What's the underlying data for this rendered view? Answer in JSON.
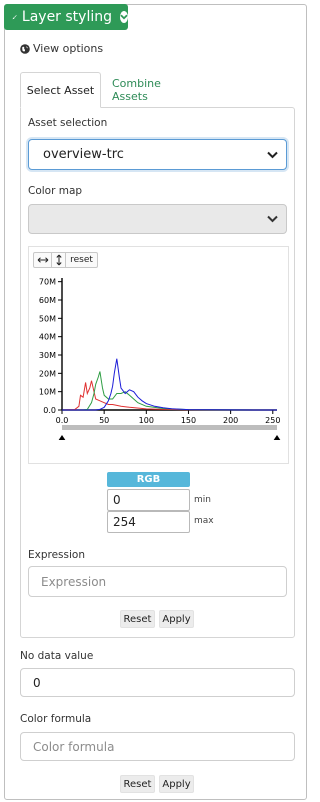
{
  "header": {
    "title": "Layer styling"
  },
  "view_options": {
    "label": "View options"
  },
  "tabs": [
    {
      "label": "Select Asset",
      "active": true
    },
    {
      "label": "Combine Assets",
      "active": false
    }
  ],
  "asset_selection": {
    "label": "Asset selection",
    "value": "overview-trc"
  },
  "color_map": {
    "label": "Color map",
    "value": ""
  },
  "histogram": {
    "toolbar": {
      "reset_label": "reset"
    },
    "chart_data": {
      "type": "line",
      "xlim": [
        0,
        255
      ],
      "ylim": [
        0,
        72000000
      ],
      "x_ticks": [
        "0.0",
        "50",
        "100",
        "150",
        "200",
        "250"
      ],
      "y_ticks": [
        "0.0",
        "10M",
        "20M",
        "30M",
        "40M",
        "50M",
        "60M",
        "70M"
      ],
      "series": [
        {
          "color": "#e03131",
          "x": [
            0,
            15,
            20,
            22,
            25,
            28,
            30,
            33,
            35,
            38,
            40,
            45,
            50,
            55,
            60,
            65,
            70,
            80,
            100,
            120,
            150,
            200,
            255
          ],
          "y": [
            0,
            200000,
            2000000,
            8000000,
            7000000,
            15000000,
            9000000,
            12000000,
            16000000,
            10000000,
            6000000,
            5000000,
            4000000,
            3000000,
            3000000,
            2500000,
            2000000,
            1500000,
            600000,
            300000,
            100000,
            20000,
            0
          ]
        },
        {
          "color": "#2f9e44",
          "x": [
            0,
            25,
            30,
            35,
            38,
            40,
            43,
            45,
            48,
            50,
            55,
            60,
            65,
            70,
            75,
            80,
            85,
            90,
            100,
            120,
            150,
            200,
            255
          ],
          "y": [
            0,
            0,
            300000,
            4000000,
            9000000,
            14000000,
            18000000,
            21000000,
            12000000,
            8000000,
            6000000,
            6000000,
            9000000,
            9000000,
            10000000,
            8000000,
            6000000,
            4000000,
            2000000,
            800000,
            200000,
            30000,
            0
          ]
        },
        {
          "color": "#1c1cd8",
          "x": [
            0,
            40,
            45,
            50,
            55,
            58,
            60,
            62,
            65,
            68,
            70,
            75,
            80,
            85,
            90,
            95,
            100,
            110,
            120,
            130,
            150,
            200,
            255
          ],
          "y": [
            0,
            0,
            300000,
            1500000,
            5000000,
            9000000,
            13000000,
            20000000,
            28000000,
            18000000,
            12000000,
            9000000,
            11000000,
            10000000,
            7000000,
            5000000,
            3500000,
            2000000,
            1200000,
            700000,
            200000,
            30000,
            0
          ]
        }
      ]
    }
  },
  "rgb": {
    "badge": "RGB",
    "min_value": "0",
    "min_label": "min",
    "max_value": "254",
    "max_label": "max"
  },
  "expression": {
    "label": "Expression",
    "placeholder": "Expression"
  },
  "panel_buttons": {
    "reset": "Reset",
    "apply": "Apply"
  },
  "no_data": {
    "label": "No data value",
    "value": "0"
  },
  "color_formula": {
    "label": "Color formula",
    "placeholder": "Color formula"
  },
  "bottom_buttons": {
    "reset": "Reset",
    "apply": "Apply"
  },
  "colors": {
    "accent": "#2e9a57",
    "rgb_badge": "#56b7da",
    "focus_border": "#5b9bd5"
  }
}
